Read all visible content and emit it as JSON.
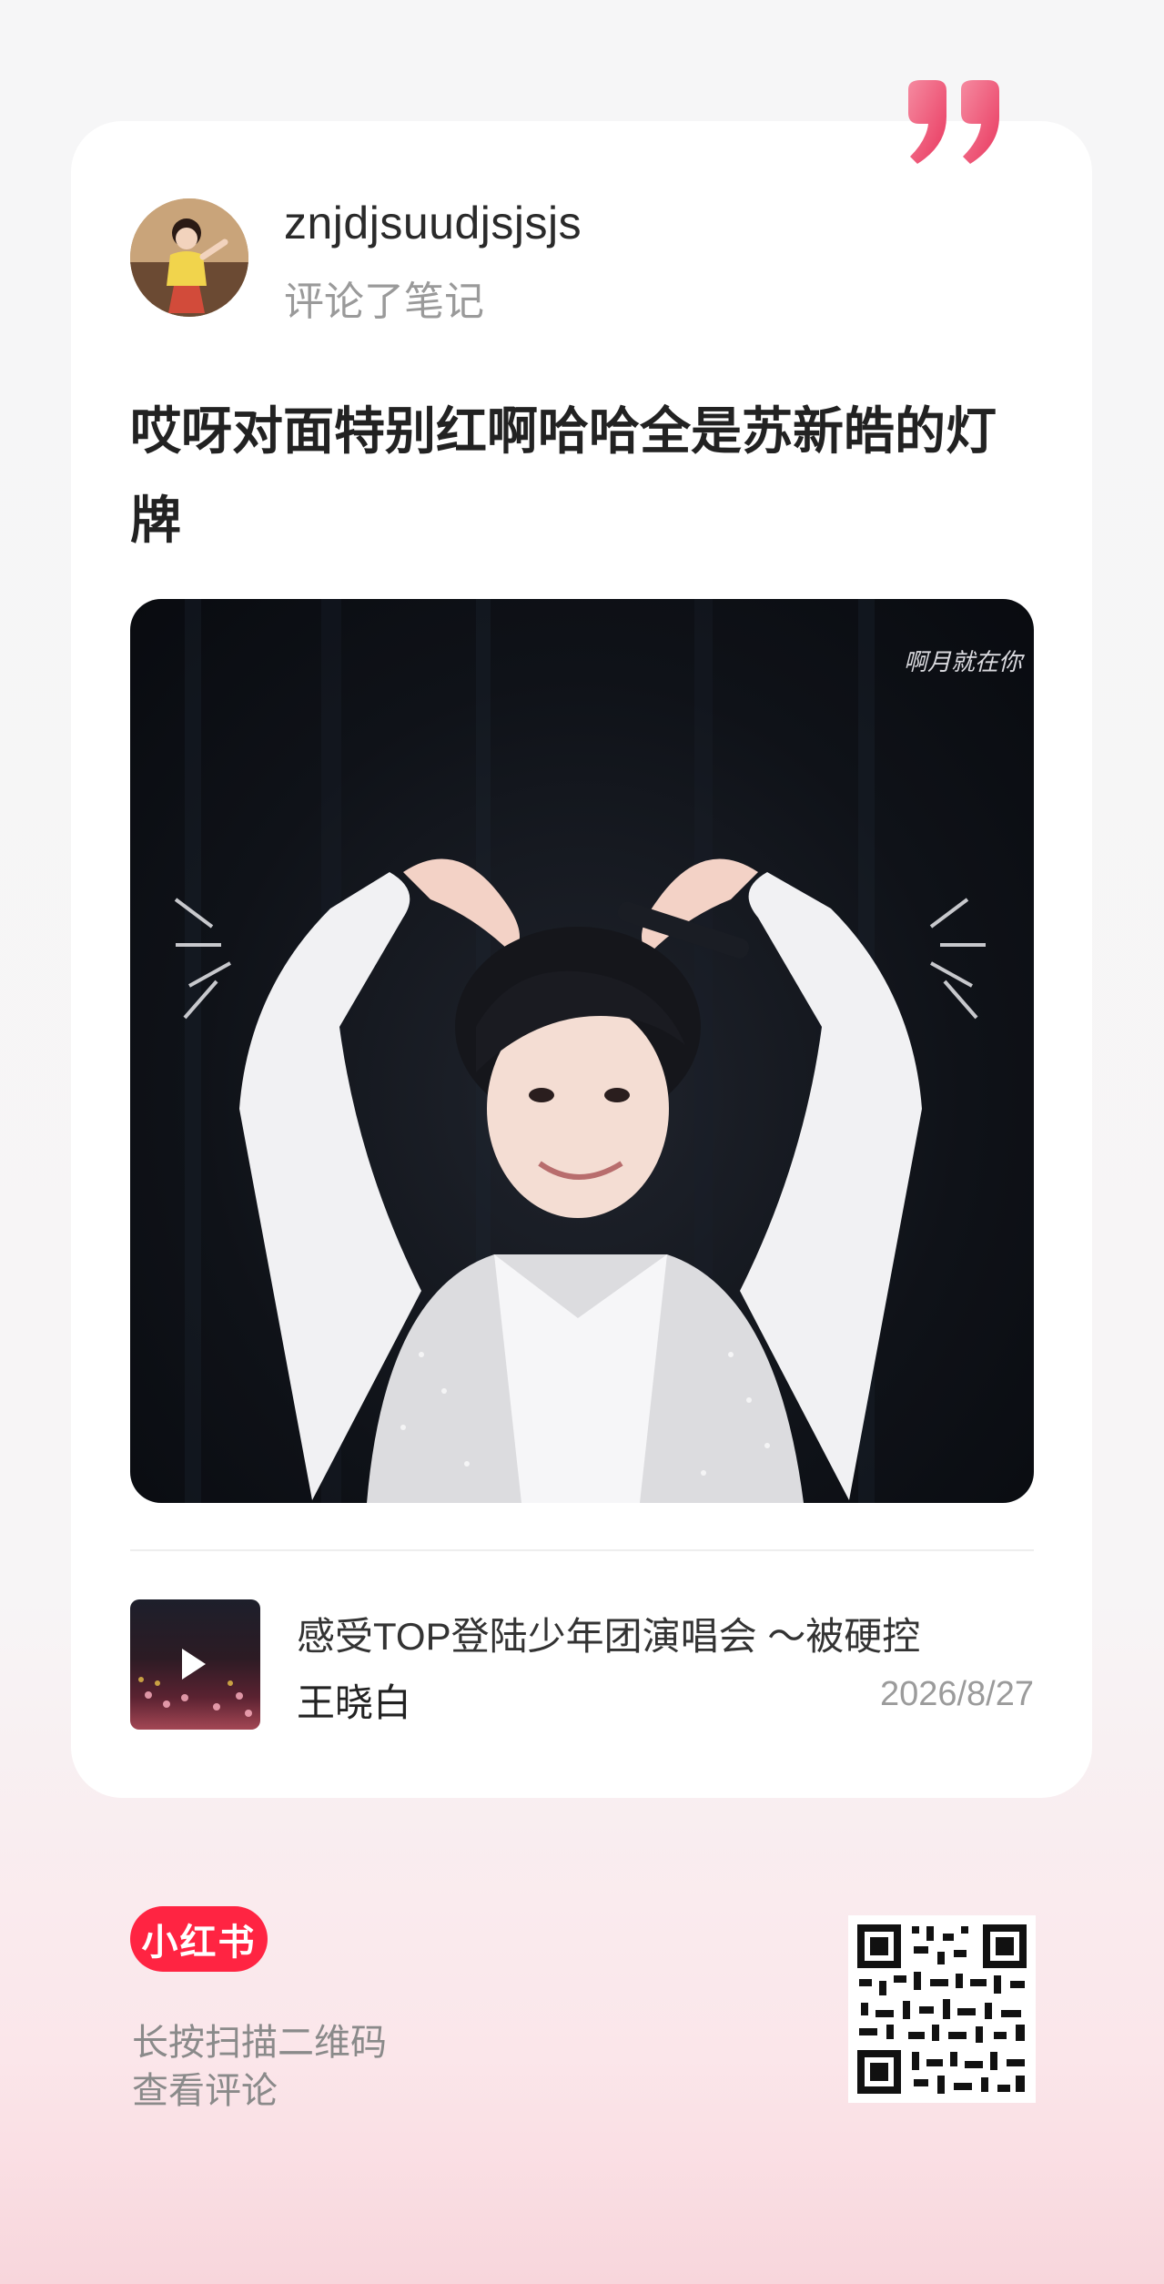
{
  "post": {
    "username": "znjdjsuudjsjsjs",
    "action": "评论了笔记",
    "comment": "哎呀对面特别红啊哈哈全是苏新皓的灯牌",
    "image_watermark": "啊月就在你"
  },
  "note": {
    "title": "感受TOP登陆少年团演唱会 ～被硬控",
    "author": "王晓白",
    "date": "2026/8/27"
  },
  "footer": {
    "logo_text": "小红书",
    "scan_line1": "长按扫描二维码",
    "scan_line2": "查看评论"
  },
  "colors": {
    "brand": "#ff2442",
    "quote": "#f45a78"
  },
  "icons": [
    "quote-icon",
    "play-icon",
    "qr-code"
  ]
}
